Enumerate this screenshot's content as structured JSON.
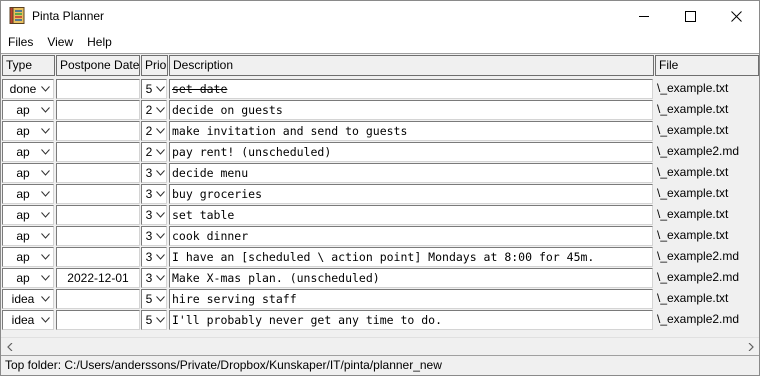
{
  "window": {
    "title": "Pinta Planner"
  },
  "menu": [
    {
      "label": "Files"
    },
    {
      "label": "View"
    },
    {
      "label": "Help"
    }
  ],
  "columns": {
    "type": "Type",
    "postpone": "Postpone Date",
    "prio": "Prio",
    "description": "Description",
    "file": "File"
  },
  "rows": [
    {
      "type": "done",
      "date": "",
      "prio": "5",
      "description": "set date",
      "file": "\\_example.txt",
      "done": true
    },
    {
      "type": "ap",
      "date": "",
      "prio": "2",
      "description": "decide on guests",
      "file": "\\_example.txt"
    },
    {
      "type": "ap",
      "date": "",
      "prio": "2",
      "description": "make invitation and send to guests",
      "file": "\\_example.txt"
    },
    {
      "type": "ap",
      "date": "",
      "prio": "2",
      "description": "pay rent! (unscheduled)",
      "file": "\\_example2.md"
    },
    {
      "type": "ap",
      "date": "",
      "prio": "3",
      "description": "decide menu",
      "file": "\\_example.txt"
    },
    {
      "type": "ap",
      "date": "",
      "prio": "3",
      "description": "buy groceries",
      "file": "\\_example.txt"
    },
    {
      "type": "ap",
      "date": "",
      "prio": "3",
      "description": "set table",
      "file": "\\_example.txt"
    },
    {
      "type": "ap",
      "date": "",
      "prio": "3",
      "description": "cook dinner",
      "file": "\\_example.txt"
    },
    {
      "type": "ap",
      "date": "",
      "prio": "3",
      "description": "I have an [scheduled \\ action point] Mondays at 8:00 for 45m.",
      "file": "\\_example2.md"
    },
    {
      "type": "ap",
      "date": "2022-12-01",
      "prio": "3",
      "description": "Make X-mas plan. (unscheduled)",
      "file": "\\_example2.md"
    },
    {
      "type": "idea",
      "date": "",
      "prio": "5",
      "description": "hire serving staff",
      "file": "\\_example.txt"
    },
    {
      "type": "idea",
      "date": "",
      "prio": "5",
      "description": "I'll probably never get any time to do.",
      "file": "\\_example2.md"
    }
  ],
  "status": {
    "text": "Top folder: C:/Users/anderssons/Private/Dropbox/Kunskaper/IT/pinta/planner_new"
  },
  "icons": {
    "app": "notebook-icon",
    "dropdown": "chevron-down-icon"
  }
}
